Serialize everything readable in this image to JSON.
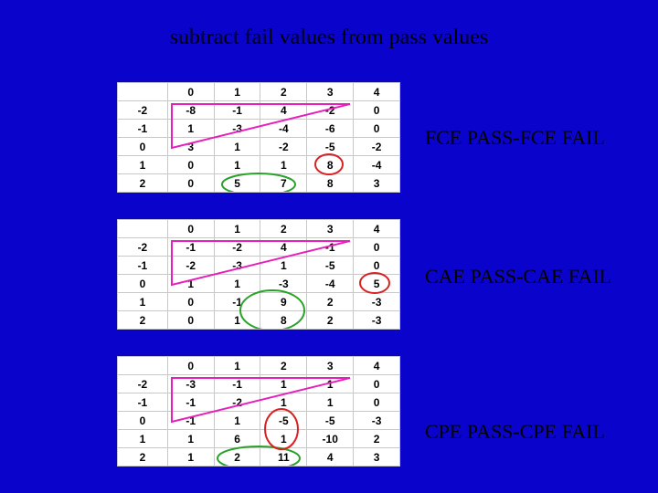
{
  "title": "subtract fail values from pass values",
  "tables": {
    "fce": {
      "label": "FCE PASS-FCE FAIL",
      "header": [
        "",
        "0",
        "1",
        "2",
        "3",
        "4"
      ],
      "rows": [
        [
          "-2",
          "-8",
          "-1",
          "4",
          "-2",
          "0"
        ],
        [
          "-1",
          "1",
          "-3",
          "-4",
          "-6",
          "0"
        ],
        [
          "0",
          "3",
          "1",
          "-2",
          "-5",
          "-2"
        ],
        [
          "1",
          "0",
          "1",
          "1",
          "8",
          "-4"
        ],
        [
          "2",
          "0",
          "5",
          "7",
          "8",
          "3"
        ]
      ]
    },
    "cae": {
      "label": "CAE PASS-CAE FAIL",
      "header": [
        "",
        "0",
        "1",
        "2",
        "3",
        "4"
      ],
      "rows": [
        [
          "-2",
          "-1",
          "-2",
          "4",
          "-1",
          "0"
        ],
        [
          "-1",
          "-2",
          "-3",
          "1",
          "-5",
          "0"
        ],
        [
          "0",
          "1",
          "1",
          "-3",
          "-4",
          "5"
        ],
        [
          "1",
          "0",
          "-1",
          "9",
          "2",
          "-3"
        ],
        [
          "2",
          "0",
          "1",
          "8",
          "2",
          "-3"
        ]
      ]
    },
    "cpe": {
      "label": "CPE PASS-CPE FAIL",
      "header": [
        "",
        "0",
        "1",
        "2",
        "3",
        "4"
      ],
      "rows": [
        [
          "-2",
          "-3",
          "-1",
          "1",
          "1",
          "0"
        ],
        [
          "-1",
          "-1",
          "-2",
          "1",
          "1",
          "0"
        ],
        [
          "0",
          "-1",
          "1",
          "-5",
          "-5",
          "-3"
        ],
        [
          "1",
          "1",
          "6",
          "1",
          "-10",
          "2"
        ],
        [
          "2",
          "1",
          "2",
          "11",
          "4",
          "3"
        ]
      ]
    }
  }
}
